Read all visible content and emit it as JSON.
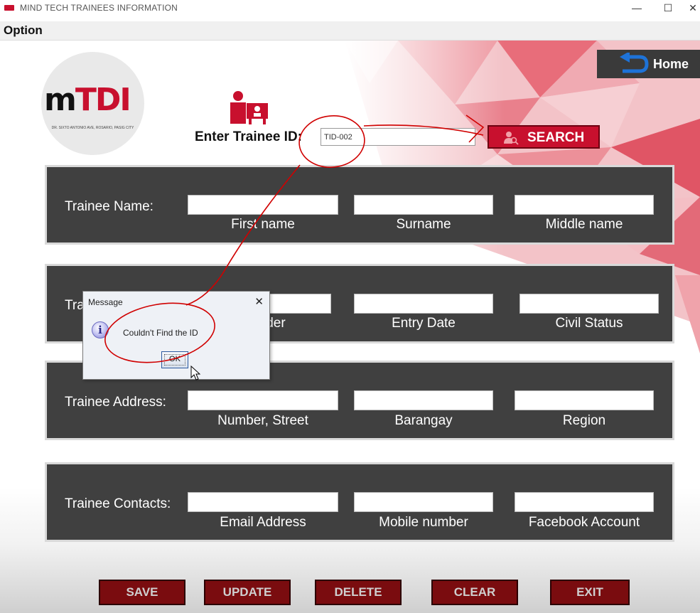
{
  "window": {
    "title": "MIND TECH TRAINEES INFORMATION",
    "controls": [
      "—",
      "☐",
      "✕"
    ]
  },
  "menu": {
    "items": [
      "Option"
    ]
  },
  "logo": {
    "text_a": "m",
    "text_b": "TDI",
    "subtitle": "DR. SIXTO ANTONIO AVE, ROSARIO, PASIG CITY"
  },
  "search": {
    "label": "Enter Trainee ID:",
    "value": "TID-002",
    "button_label": "SEARCH"
  },
  "home": {
    "label": "Home"
  },
  "panels": [
    {
      "label": "Trainee Name:",
      "fields": [
        "First name",
        "Surname",
        "Middle name"
      ]
    },
    {
      "label": "Trainee ID:",
      "fields": [
        "Gender",
        "Entry Date",
        "Civil Status"
      ]
    },
    {
      "label": "Trainee Address:",
      "fields": [
        "Number, Street",
        "Barangay",
        "Region"
      ]
    },
    {
      "label": "Trainee Contacts:",
      "fields": [
        "Email Address",
        "Mobile number",
        "Facebook Account"
      ]
    }
  ],
  "actions": [
    "SAVE",
    "UPDATE",
    "DELETE",
    "CLEAR",
    "EXIT"
  ],
  "dialog": {
    "title": "Message",
    "close": "✕",
    "icon": "info-icon",
    "message": "Couldn't Find the ID",
    "ok_label": "OK"
  },
  "colors": {
    "accent": "#c8102e",
    "panel": "#404040",
    "action_button": "#7a0c0f",
    "home_button": "#3a3a3a",
    "annotation": "#d00000"
  }
}
